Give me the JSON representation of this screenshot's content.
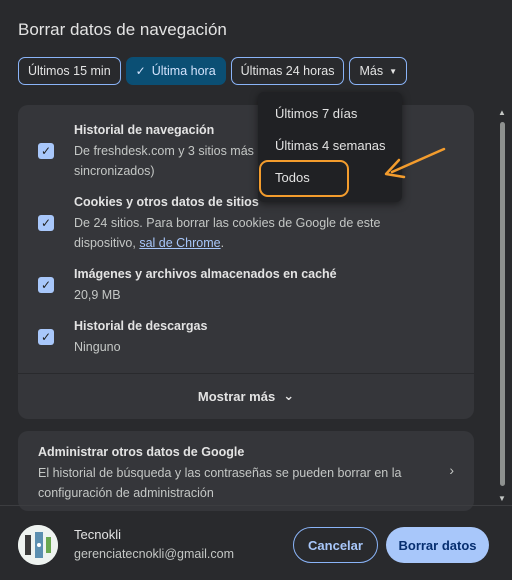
{
  "dialog": {
    "title": "Borrar datos de navegación"
  },
  "time_chips": [
    {
      "label": "Últimos 15 min",
      "selected": false
    },
    {
      "label": "Última hora",
      "selected": true
    },
    {
      "label": "Últimas 24 horas",
      "selected": false
    },
    {
      "label": "Más",
      "selected": false
    }
  ],
  "items": [
    {
      "title": "Historial de navegación",
      "desc1": "De freshdesk.com y 3 sitios más",
      "desc2": "sincronizados)",
      "checked": true
    },
    {
      "title": "Cookies y otros datos de sitios",
      "desc1": "De 24 sitios. Para borrar las cookies de Google de este",
      "desc2": "dispositivo,",
      "link": "sal de Chrome",
      "desc3": ".",
      "checked": true
    },
    {
      "title": "Imágenes y archivos almacenados en caché",
      "desc1": "20,9 MB",
      "checked": true
    },
    {
      "title": "Historial de descargas",
      "desc1": "Ninguno",
      "checked": true
    }
  ],
  "show_more": {
    "label": "Mostrar más"
  },
  "google_data": {
    "title": "Administrar otros datos de Google",
    "desc": "El historial de búsqueda y las contraseñas se pueden borrar en la configuración de administración"
  },
  "account": {
    "name": "Tecnokli",
    "email": "gerenciatecnokli@gmail.com"
  },
  "buttons": {
    "cancel": "Cancelar",
    "clear": "Borrar datos"
  },
  "dropdown": {
    "options": [
      "Últimos 7 días",
      "Últimas 4 semanas",
      "Todos"
    ]
  },
  "colors": {
    "accent": "#a8c7fa",
    "selected_chip": "#0b4f74",
    "annotation": "#f39c2d"
  }
}
